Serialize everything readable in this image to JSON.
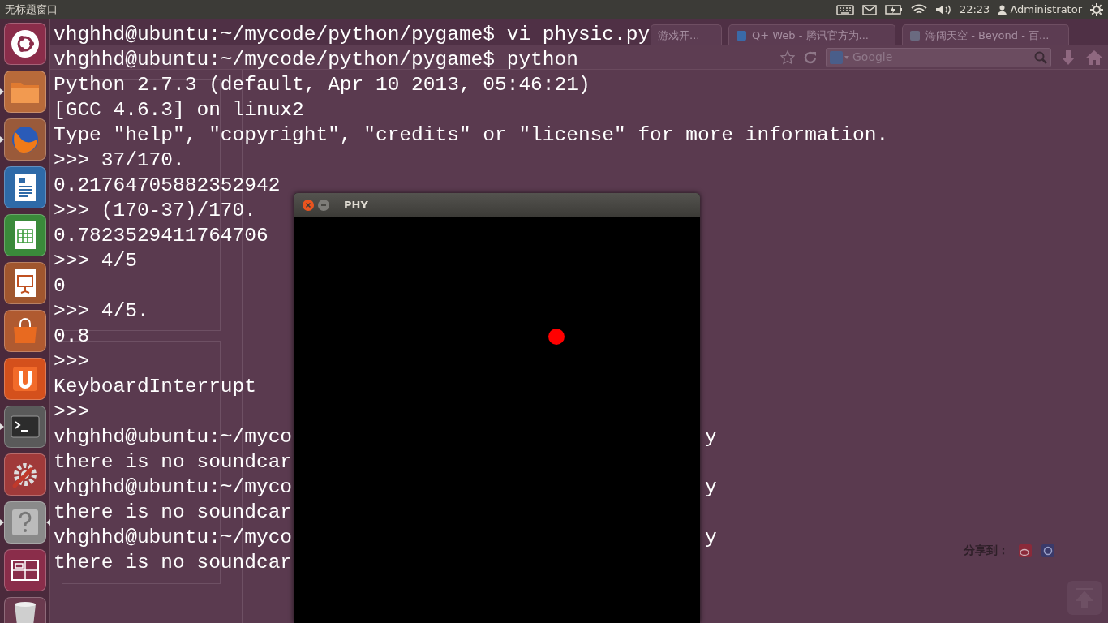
{
  "top_panel": {
    "title": "无标题窗口",
    "clock": "22:23",
    "user": "Administrator"
  },
  "launcher": [
    {
      "kind": "dash",
      "running": false,
      "focused": false
    },
    {
      "kind": "files",
      "running": true,
      "focused": false
    },
    {
      "kind": "browser",
      "running": true,
      "focused": false
    },
    {
      "kind": "writer",
      "running": false,
      "focused": false
    },
    {
      "kind": "calc",
      "running": false,
      "focused": false
    },
    {
      "kind": "impress",
      "running": false,
      "focused": false
    },
    {
      "kind": "store",
      "running": false,
      "focused": false
    },
    {
      "kind": "ubuntuone",
      "running": false,
      "focused": false
    },
    {
      "kind": "terminal",
      "running": true,
      "focused": false
    },
    {
      "kind": "settings",
      "running": false,
      "focused": false
    },
    {
      "kind": "help",
      "running": true,
      "focused": true
    },
    {
      "kind": "workspaces",
      "running": false,
      "focused": false
    },
    {
      "kind": "trash",
      "running": false,
      "focused": false
    }
  ],
  "browser": {
    "tabs": [
      {
        "title": "游戏开..."
      },
      {
        "title": "Q+ Web - 腾讯官方为..."
      },
      {
        "title": "海阔天空 - Beyond - 百..."
      }
    ],
    "search": {
      "placeholder": "Google"
    },
    "share_label": "分享到："
  },
  "terminal": {
    "lines": [
      {
        "text": "vhghhd@ubuntu:~/mycode/python/pygame$ vi physic.py"
      },
      {
        "text": "vhghhd@ubuntu:~/mycode/python/pygame$ python"
      },
      {
        "text": "Python 2.7.3 (default, Apr 10 2013, 05:46:21)"
      },
      {
        "text": "[GCC 4.6.3] on linux2"
      },
      {
        "text": "Type \"help\", \"copyright\", \"credits\" or \"license\" for more information."
      },
      {
        "text": ">>> 37/170."
      },
      {
        "text": "0.21764705882352942"
      },
      {
        "text": ">>> (170-37)/170."
      },
      {
        "text": "0.7823529411764706"
      },
      {
        "text": ">>> 4/5"
      },
      {
        "text": "0"
      },
      {
        "text": ">>> 4/5."
      },
      {
        "text": "0.8"
      },
      {
        "text": ">>>"
      },
      {
        "text": "KeyboardInterrupt"
      },
      {
        "text": ">>>"
      },
      {
        "text": "vhghhd@ubuntu:~/myco",
        "tail": "y"
      },
      {
        "text": "there is no soundcar"
      },
      {
        "text": "vhghhd@ubuntu:~/myco",
        "tail": "y"
      },
      {
        "text": "there is no soundcar"
      },
      {
        "text": "vhghhd@ubuntu:~/myco",
        "tail": "y"
      },
      {
        "text": "there is no soundcar"
      }
    ]
  },
  "game_window": {
    "title": "PHY"
  }
}
